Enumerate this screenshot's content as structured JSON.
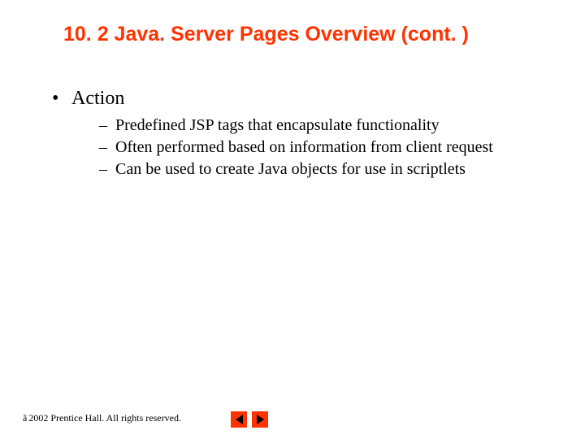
{
  "title": "10. 2   Java. Server Pages Overview (cont. )",
  "bullets": {
    "item1": {
      "label": "Action",
      "subs": [
        "Predefined JSP tags that encapsulate functionality",
        "Often performed based on information from client request",
        "Can be used to create Java objects for use in scriptlets"
      ]
    }
  },
  "footer": {
    "copyright_symbol": "ã",
    "text": " 2002 Prentice Hall. All rights reserved."
  },
  "icons": {
    "prev": "previous-slide",
    "next": "next-slide"
  }
}
